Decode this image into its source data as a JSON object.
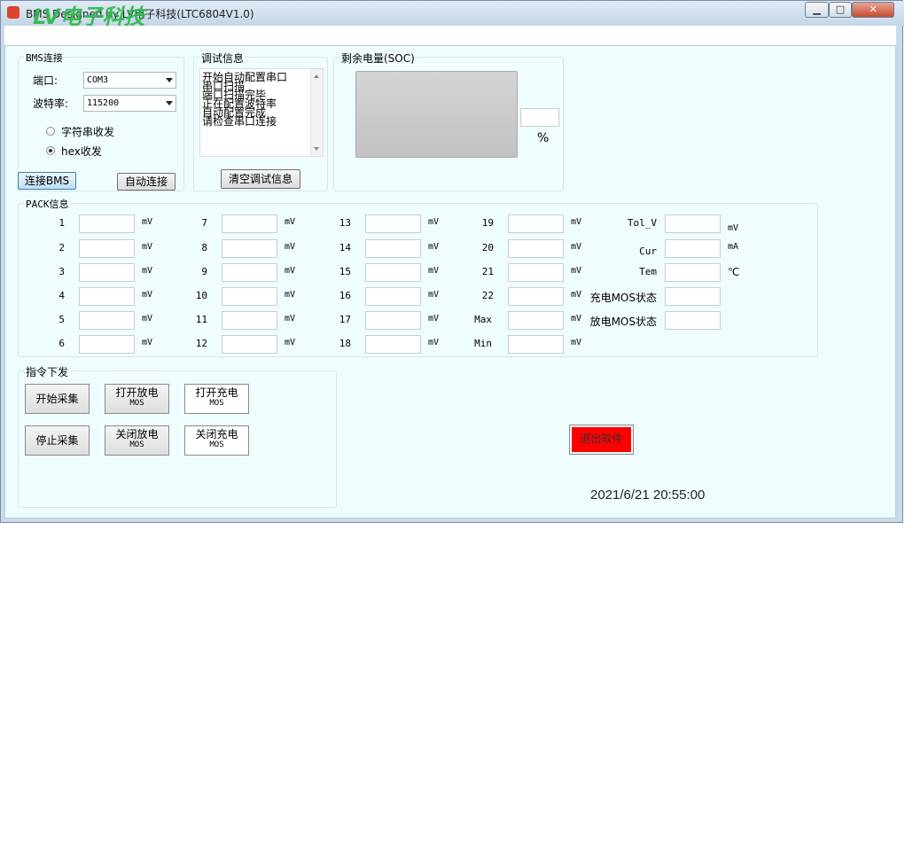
{
  "window": {
    "title": "BMS Designed by LV电子科技(LTC6804V1.0)",
    "watermark": "LV电子科技",
    "minimize_glyph": "▁",
    "maximize_glyph": "□",
    "close_glyph": "✕"
  },
  "bms_conn": {
    "group_label": "BMS连接",
    "port_label": "端口:",
    "port_value": "COM3",
    "baud_label": "波特率:",
    "baud_value": "115200",
    "radio_string": "字符串收发",
    "radio_hex": "hex收发",
    "selected_mode": "hex",
    "connect_button": "连接BMS",
    "auto_connect_button": "自动连接"
  },
  "debug": {
    "group_label": "调试信息",
    "lines": [
      "开始自动配置串口",
      "串口扫描",
      "端口扫描完毕",
      "正在配置波特率",
      "自动配置完成",
      "请检查串口连接"
    ],
    "clear_button": "清空调试信息"
  },
  "soc": {
    "group_label": "剩余电量(SOC)",
    "value": "",
    "unit": "%"
  },
  "pack": {
    "group_label": "PACK信息",
    "unit": "mV",
    "cells": [
      "1",
      "2",
      "3",
      "4",
      "5",
      "6",
      "7",
      "8",
      "9",
      "10",
      "11",
      "12",
      "13",
      "14",
      "15",
      "16",
      "17",
      "18",
      "19",
      "20",
      "21",
      "22",
      "Max",
      "Min"
    ],
    "extras": [
      {
        "label": "Tol_V",
        "unit": "mV"
      },
      {
        "label": "Cur",
        "unit": "mA"
      },
      {
        "label": "Tem",
        "unit": "℃"
      },
      {
        "label": "充电MOS状态",
        "unit": ""
      },
      {
        "label": "放电MOS状态",
        "unit": ""
      }
    ]
  },
  "commands": {
    "group_label": "指令下发",
    "start_collect": "开始采集",
    "stop_collect": "停止采集",
    "open_discharge_l1": "打开放电",
    "open_discharge_l2": "MOS",
    "open_charge_l1": "打开充电",
    "open_charge_l2": "MOS",
    "close_discharge_l1": "关闭放电",
    "close_discharge_l2": "MOS",
    "close_charge_l1": "关闭充电",
    "close_charge_l2": "MOS"
  },
  "exit_button": "退出软件",
  "datetime": "2021/6/21 20:55:00",
  "colors": {
    "exit_bg": "#ff0000",
    "client_bg": "#f0fdfe",
    "soc_bar": "#c6c6c6"
  }
}
